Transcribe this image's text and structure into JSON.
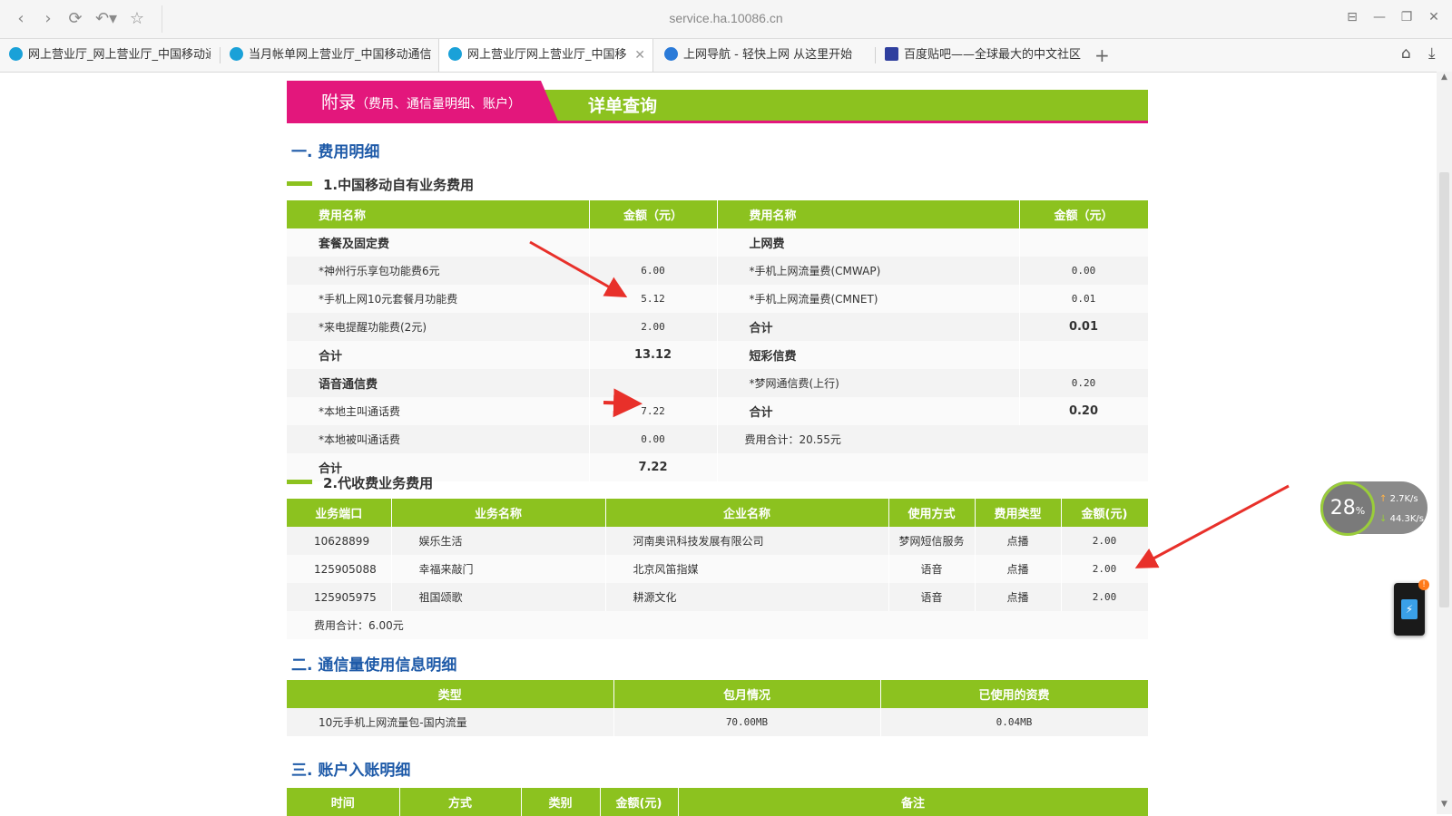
{
  "browser": {
    "url": "service.ha.10086.cn",
    "tabs": [
      {
        "label": "网上营业厅_网上营业厅_中国移动通"
      },
      {
        "label": "当月帐单网上营业厅_中国移动通信"
      },
      {
        "label": "网上营业厅网上营业厅_中国移",
        "close": "✕"
      },
      {
        "label": "上网导航 - 轻快上网 从这里开始"
      },
      {
        "label": "百度贴吧——全球最大的中文社区"
      }
    ],
    "new_tab": "+"
  },
  "banner": {
    "left_main": "附录",
    "left_sub": "（费用、通信量明细、账户）",
    "right": "详单查询"
  },
  "section1": {
    "title": "一. 费用明细",
    "sub1": {
      "title": "1.中国移动自有业务费用",
      "headers": [
        "费用名称",
        "金额（元）",
        "费用名称",
        "金额（元）"
      ],
      "rows": [
        [
          "套餐及固定费",
          "",
          "上网费",
          ""
        ],
        [
          "*神州行乐享包功能费6元",
          "6.00",
          "*手机上网流量费(CMWAP)",
          "0.00"
        ],
        [
          "*手机上网10元套餐月功能费",
          "5.12",
          "*手机上网流量费(CMNET)",
          "0.01"
        ],
        [
          "*来电提醒功能费(2元)",
          "2.00",
          "合计",
          "0.01"
        ],
        [
          "合计",
          "13.12",
          "短彩信费",
          ""
        ],
        [
          "语音通信费",
          "",
          "*梦网通信费(上行)",
          "0.20"
        ],
        [
          "*本地主叫通话费",
          "7.22",
          "合计",
          "0.20"
        ],
        [
          "*本地被叫通话费",
          "0.00",
          "费用合计：20.55元",
          ""
        ],
        [
          "合计",
          "7.22",
          "",
          ""
        ]
      ]
    },
    "sub2": {
      "title": "2.代收费业务费用",
      "headers": [
        "业务端口",
        "业务名称",
        "企业名称",
        "使用方式",
        "费用类型",
        "金额(元)"
      ],
      "rows": [
        [
          "10628899",
          "娱乐生活",
          "河南奥讯科技发展有限公司",
          "梦网短信服务",
          "点播",
          "2.00"
        ],
        [
          "125905088",
          "幸福来敲门",
          "北京风笛指媒",
          "语音",
          "点播",
          "2.00"
        ],
        [
          "125905975",
          "祖国颂歌",
          "耕源文化",
          "语音",
          "点播",
          "2.00"
        ]
      ],
      "total": "费用合计：6.00元"
    }
  },
  "section2": {
    "title": "二. 通信量使用信息明细",
    "headers": [
      "类型",
      "包月情况",
      "已使用的资费"
    ],
    "rows": [
      [
        "10元手机上网流量包-国内流量",
        "70.00MB",
        "0.04MB"
      ]
    ]
  },
  "section3": {
    "title": "三. 账户入账明细",
    "headers": [
      "时间",
      "方式",
      "类别",
      "金额(元)",
      "备注"
    ]
  },
  "net_widget": {
    "percent": "28",
    "percent_unit": "%",
    "up": "2.7",
    "down": "44.3",
    "unit": "K/s"
  },
  "colors": {
    "green": "#8cc21f",
    "pink": "#e3177c",
    "blue_title": "#1e5aa8",
    "arrow_red": "#e8302a"
  }
}
